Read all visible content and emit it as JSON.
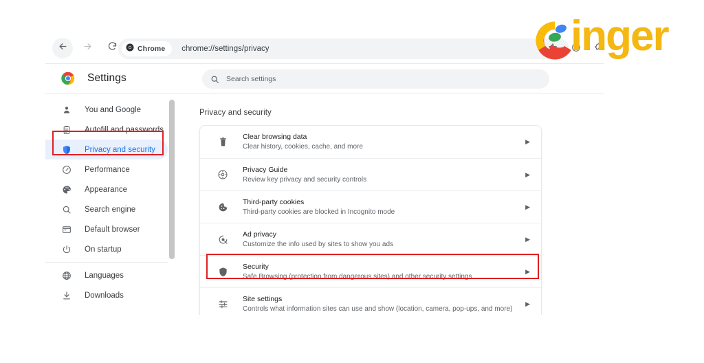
{
  "browser": {
    "toolbar": {
      "back_icon": "back-arrow-icon",
      "forward_icon": "forward-arrow-icon",
      "reload_icon": "reload-icon",
      "chip_label": "Chrome",
      "chip_icon": "chrome-logo-icon",
      "url": "chrome://settings/privacy",
      "star_icon": "bookmark-star-icon",
      "leaf_icon": "memory-saver-leaf-icon",
      "extensions_icon": "extensions-icon",
      "profile_icon": "profile-avatar-icon"
    }
  },
  "settings": {
    "brand_icon": "chrome-logo-icon",
    "title": "Settings",
    "search": {
      "icon": "search-icon",
      "placeholder": "Search settings",
      "value": ""
    }
  },
  "sidebar": {
    "items": [
      {
        "label": "You and Google",
        "icon": "person-icon",
        "active": false
      },
      {
        "label": "Autofill and passwords",
        "icon": "clipboard-icon",
        "active": false
      },
      {
        "label": "Privacy and security",
        "icon": "shield-icon",
        "active": true
      },
      {
        "label": "Performance",
        "icon": "speedometer-icon",
        "active": false
      },
      {
        "label": "Appearance",
        "icon": "palette-icon",
        "active": false
      },
      {
        "label": "Search engine",
        "icon": "magnifier-icon",
        "active": false
      },
      {
        "label": "Default browser",
        "icon": "browser-window-icon",
        "active": false
      },
      {
        "label": "On startup",
        "icon": "power-icon",
        "active": false
      }
    ],
    "items_group2": [
      {
        "label": "Languages",
        "icon": "globe-icon",
        "active": false
      },
      {
        "label": "Downloads",
        "icon": "download-icon",
        "active": false
      }
    ],
    "scrollbar": {
      "icon": "scrollbar-thumb"
    }
  },
  "main": {
    "section_title": "Privacy and security",
    "rows": [
      {
        "title": "Clear browsing data",
        "subtitle": "Clear history, cookies, cache, and more",
        "icon": "trash-icon",
        "arrow": "chevron-right-icon",
        "highlighted": false
      },
      {
        "title": "Privacy Guide",
        "subtitle": "Review key privacy and security controls",
        "icon": "privacy-guide-icon",
        "arrow": "chevron-right-icon",
        "highlighted": false
      },
      {
        "title": "Third-party cookies",
        "subtitle": "Third-party cookies are blocked in Incognito mode",
        "icon": "cookie-icon",
        "arrow": "chevron-right-icon",
        "highlighted": false
      },
      {
        "title": "Ad privacy",
        "subtitle": "Customize the info used by sites to show you ads",
        "icon": "ad-privacy-icon",
        "arrow": "chevron-right-icon",
        "highlighted": false
      },
      {
        "title": "Security",
        "subtitle": "Safe Browsing (protection from dangerous sites) and other security settings",
        "icon": "shield-icon",
        "arrow": "chevron-right-icon",
        "highlighted": true
      },
      {
        "title": "Site settings",
        "subtitle": "Controls what information sites can use and show (location, camera, pop-ups, and more)",
        "icon": "sliders-icon",
        "arrow": "chevron-right-icon",
        "highlighted": false
      }
    ]
  },
  "annotations": {
    "highlight_color": "#e02020",
    "boxes": [
      {
        "target": "sidebar-item-privacy-and-security"
      },
      {
        "target": "settings-row-security"
      }
    ]
  },
  "watermark": {
    "text": "inger",
    "logo_icon": "google-g-icon",
    "color": "#f5b711"
  },
  "colors": {
    "accent_blue": "#1a73e8",
    "selected_pill": "#e8f0fe",
    "text_primary": "#202124",
    "text_secondary": "#5f6368",
    "toolbar_field": "#f1f3f4"
  }
}
